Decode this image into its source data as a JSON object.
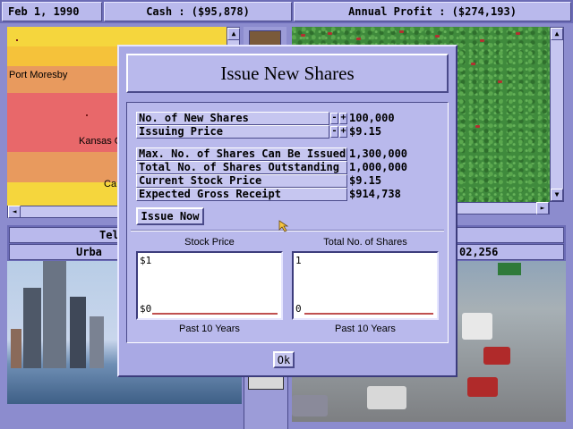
{
  "status_bar": {
    "date": "Feb 1, 1990",
    "cash": "Cash : ($95,878)",
    "annual_profit": "Annual Profit : ($274,193)"
  },
  "map": {
    "labels": [
      "Port Moresby",
      "Kansas C",
      "Ca"
    ]
  },
  "info_bar": {
    "left_top": "Tel",
    "left_bottom": "Urba",
    "right_bottom": "02,256"
  },
  "dialog": {
    "title": "Issue New Shares",
    "fields": {
      "new_shares_label": "No. of New Shares",
      "new_shares_value": "100,000",
      "issuing_price_label": "Issuing Price",
      "issuing_price_value": "$9.15",
      "max_shares_label": "Max. No. of Shares Can Be Issued",
      "max_shares_value": "1,300,000",
      "total_outstanding_label": "Total No. of Shares Outstanding",
      "total_outstanding_value": "1,000,000",
      "current_price_label": "Current Stock Price",
      "current_price_value": "$9.15",
      "gross_receipt_label": "Expected Gross Receipt",
      "gross_receipt_value": "$914,738"
    },
    "spin_minus": "-",
    "spin_plus": "+",
    "issue_button": "Issue Now",
    "ok_button": "Ok",
    "charts": {
      "stock_price": {
        "title": "Stock Price",
        "top_label": "$1",
        "bottom_label": "$0",
        "footer": "Past 10 Years"
      },
      "total_shares": {
        "title": "Total No. of Shares",
        "top_label": "1",
        "bottom_label": "0",
        "footer": "Past 10 Years"
      }
    }
  },
  "colors": {
    "dialog_bg": "#a9a9e4",
    "panel_bg": "#b9b9ec",
    "baseline": "#c05050"
  },
  "icons": {
    "scroll_up": "▲",
    "scroll_down": "▼",
    "scroll_left": "◄",
    "scroll_right": "►"
  }
}
